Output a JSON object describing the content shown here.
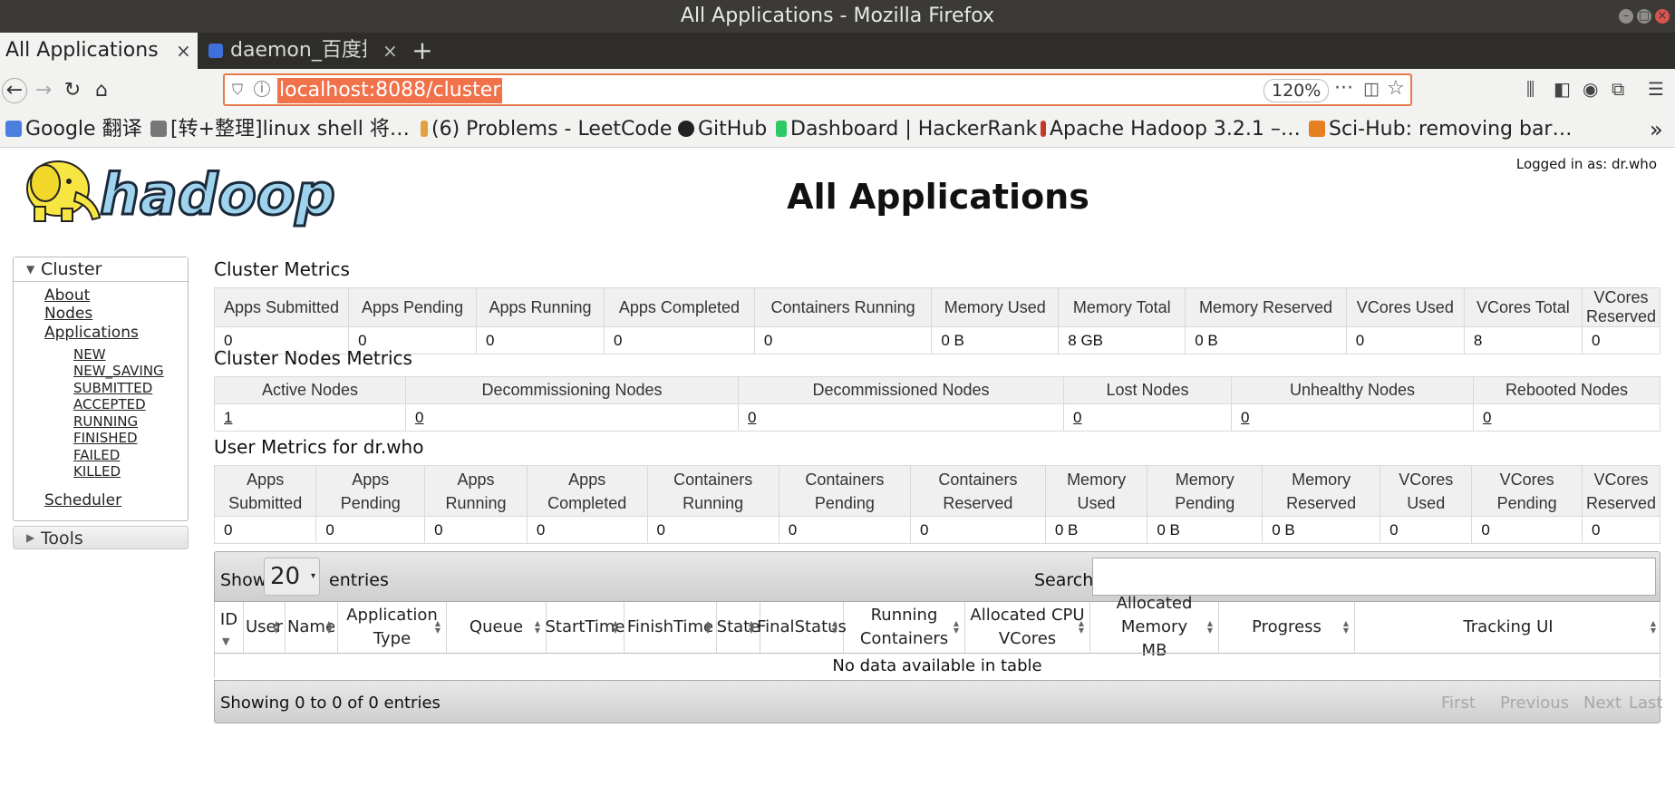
{
  "window": {
    "title": "All Applications - Mozilla Firefox"
  },
  "tabs": [
    {
      "label": "All Applications",
      "close": "×"
    },
    {
      "label": "daemon_百度搜",
      "close": "×"
    }
  ],
  "newtab": "+",
  "nav": {
    "back": "←",
    "forward": "→",
    "reload": "↻",
    "home": "⌂",
    "url": "localhost:8088/cluster",
    "zoom": "120%",
    "more": "···",
    "pocket": "◫",
    "star": "☆",
    "toolbar_icons": [
      "library-icon",
      "sidebar-icon",
      "account-icon",
      "extension-icon",
      "menu-icon"
    ]
  },
  "bookmarks": [
    {
      "label": "Google 翻译",
      "icon_color": "#4a7fe0"
    },
    {
      "label": "[转+整理]linux shell 将…",
      "icon_color": "#777777"
    },
    {
      "label": "(6) Problems - LeetCode",
      "icon_color": "#e2a03f"
    },
    {
      "label": "GitHub",
      "icon_color": "#222222"
    },
    {
      "label": "Dashboard | HackerRank",
      "icon_color": "#2ec866"
    },
    {
      "label": "Apache Hadoop 3.2.1 –…",
      "icon_color": "#c0392b"
    },
    {
      "label": "Sci-Hub: removing bar…",
      "icon_color": "#e67e22"
    }
  ],
  "bookmarks_overflow": "»",
  "page": {
    "logo_text": "hadoop",
    "title": "All Applications",
    "logged_in": "Logged in as: dr.who"
  },
  "sidebar": {
    "cluster_label": "Cluster",
    "links": [
      "About",
      "Nodes",
      "Applications"
    ],
    "app_states": [
      "NEW",
      "NEW_SAVING",
      "SUBMITTED",
      "ACCEPTED",
      "RUNNING",
      "FINISHED",
      "FAILED",
      "KILLED"
    ],
    "scheduler": "Scheduler",
    "tools_label": "Tools"
  },
  "cluster_metrics": {
    "title": "Cluster Metrics",
    "headers": [
      "Apps Submitted",
      "Apps Pending",
      "Apps Running",
      "Apps Completed",
      "Containers Running",
      "Memory Used",
      "Memory Total",
      "Memory Reserved",
      "VCores Used",
      "VCores Total",
      "VCores Reserved"
    ],
    "values": [
      "0",
      "0",
      "0",
      "0",
      "0",
      "0 B",
      "8 GB",
      "0 B",
      "0",
      "8",
      "0"
    ]
  },
  "node_metrics": {
    "title": "Cluster Nodes Metrics",
    "headers": [
      "Active Nodes",
      "Decommissioning Nodes",
      "Decommissioned Nodes",
      "Lost Nodes",
      "Unhealthy Nodes",
      "Rebooted Nodes"
    ],
    "values": [
      "1",
      "0",
      "0",
      "0",
      "0",
      "0"
    ]
  },
  "user_metrics": {
    "title": "User Metrics for dr.who",
    "headers": [
      [
        "Apps",
        "Submitted"
      ],
      [
        "Apps",
        "Pending"
      ],
      [
        "Apps",
        "Running"
      ],
      [
        "Apps",
        "Completed"
      ],
      [
        "Containers",
        "Running"
      ],
      [
        "Containers",
        "Pending"
      ],
      [
        "Containers",
        "Reserved"
      ],
      [
        "Memory",
        "Used"
      ],
      [
        "Memory",
        "Pending"
      ],
      [
        "Memory",
        "Reserved"
      ],
      [
        "VCores",
        "Used"
      ],
      [
        "VCores",
        "Pending"
      ],
      [
        "VCores",
        "Reserved"
      ]
    ],
    "values": [
      "0",
      "0",
      "0",
      "0",
      "0",
      "0",
      "0",
      "0 B",
      "0 B",
      "0 B",
      "0",
      "0",
      "0"
    ]
  },
  "apps_table": {
    "show_label": "Show",
    "entries_value": "20",
    "entries_label": "entries",
    "search_label": "Search:",
    "search_value": "",
    "columns": [
      [
        "ID"
      ],
      [
        "User"
      ],
      [
        "Name"
      ],
      [
        "Application",
        "Type"
      ],
      [
        "Queue"
      ],
      [
        "StartTime"
      ],
      [
        "FinishTime"
      ],
      [
        "State"
      ],
      [
        "FinalStatus"
      ],
      [
        "Running",
        "Containers"
      ],
      [
        "Allocated CPU",
        "VCores"
      ],
      [
        "Allocated Memory",
        "MB"
      ],
      [
        "Progress"
      ],
      [
        "Tracking UI"
      ]
    ],
    "empty_text": "No data available in table",
    "info_text": "Showing 0 to 0 of 0 entries",
    "pager": [
      "First",
      "Previous",
      "Next",
      "Last"
    ]
  }
}
